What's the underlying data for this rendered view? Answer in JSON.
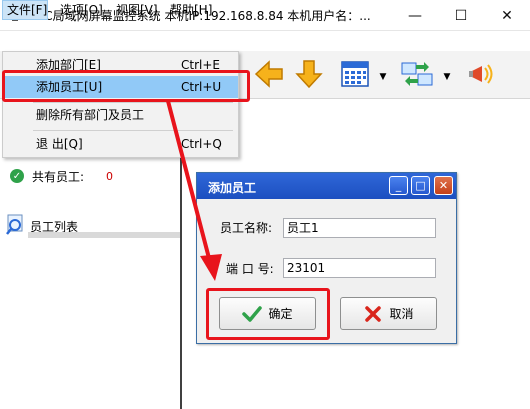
{
  "window": {
    "title": "LSC局域网屏幕监控系统    本机IP:192.168.8.84    本机用户名：...",
    "min_symbol": "—",
    "max_symbol": "☐",
    "close_symbol": "✕"
  },
  "menubar": {
    "file": "文件[F]",
    "options": "选项[O]",
    "view": "视图[V]",
    "help": "帮助[H]"
  },
  "file_menu": {
    "add_dept": {
      "label": "添加部门[E]",
      "shortcut": "Ctrl+E"
    },
    "add_emp": {
      "label": "添加员工[U]",
      "shortcut": "Ctrl+U"
    },
    "delete_all": {
      "label": "删除所有部门及员工"
    },
    "exit": {
      "label": "退 出[Q]",
      "shortcut": "Ctrl+Q"
    }
  },
  "left_panel": {
    "total_label": "共有员工:",
    "total_count": "0",
    "employee_list_title": "员工列表"
  },
  "dialog": {
    "title": "添加员工",
    "name_label": "员工名称:",
    "name_value": "员工1",
    "port_label": "端 口 号:",
    "port_value": "23101",
    "ok_label": "确定",
    "cancel_label": "取消",
    "min_symbol": "_",
    "max_symbol": "□",
    "close_symbol": "✕"
  },
  "colors": {
    "highlight_red": "#e8141c",
    "menu_selected": "#91c9f7",
    "dialog_title_blue": "#2f67d8"
  },
  "icons": {
    "app": "app-monitor-icon",
    "toolbar": [
      "arrow-left-icon",
      "arrow-down-icon",
      "calendar-grid-icon",
      "transfer-icon",
      "broadcast-megaphone-icon"
    ],
    "ok": "checkmark-icon",
    "cancel": "x-mark-icon",
    "total": "check-circle-icon",
    "list": "magnifier-icon"
  }
}
